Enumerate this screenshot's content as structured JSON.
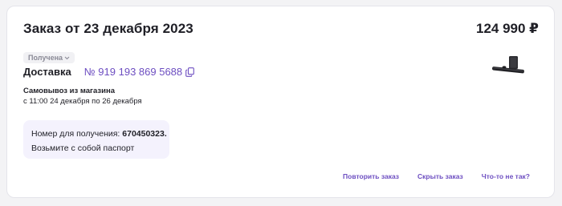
{
  "order": {
    "title": "Заказ от 23 декабря 2023",
    "total": "124 990 ₽",
    "status": "Получена",
    "delivery_label": "Доставка",
    "tracking_number": "№ 919 193 869 5688",
    "product_icon": "soundbar-with-subwoofer"
  },
  "pickup": {
    "title": "Самовывоз из магазина",
    "time": "с 11:00 24 декабря по 26 декабря",
    "code_label": "Номер для получения: ",
    "code_value": "670450323.",
    "note": "Возьмите с собой паспорт"
  },
  "actions": {
    "repeat": "Повторить заказ",
    "hide": "Скрыть заказ",
    "problem": "Что-то не так?"
  },
  "colors": {
    "accent": "#6d4ec1",
    "pickup_box_bg": "#f4f2fd",
    "badge_bg": "#f1f1f4"
  }
}
